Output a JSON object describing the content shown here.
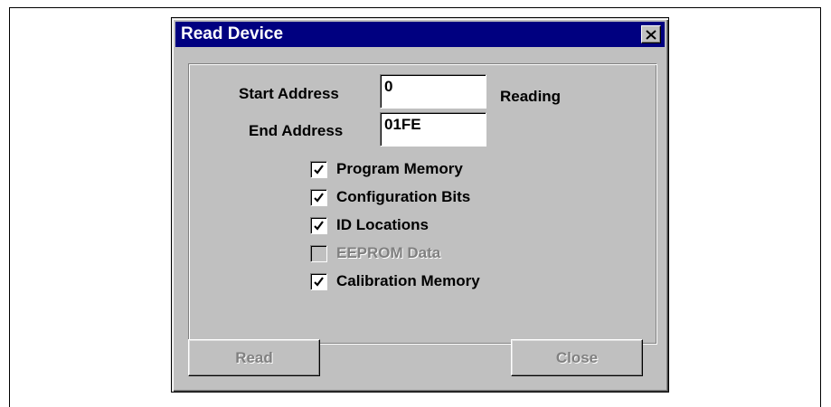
{
  "dialog": {
    "title": "Read Device",
    "close_icon": "close-x-icon"
  },
  "fields": {
    "start_address_label": "Start Address",
    "start_address_value": "0",
    "end_address_label": "End Address",
    "end_address_value": "01FE",
    "status_text": "Reading"
  },
  "checkboxes": [
    {
      "label": "Program Memory",
      "checked": true,
      "enabled": true
    },
    {
      "label": "Configuration Bits",
      "checked": true,
      "enabled": true
    },
    {
      "label": "ID Locations",
      "checked": true,
      "enabled": true
    },
    {
      "label": "EEPROM Data",
      "checked": false,
      "enabled": false
    },
    {
      "label": "Calibration Memory",
      "checked": true,
      "enabled": true
    }
  ],
  "buttons": {
    "read_label": "Read",
    "read_enabled": false,
    "close_label": "Close",
    "close_enabled": false
  },
  "colors": {
    "title_bar": "#000080",
    "dialog_face": "#c0c0c0",
    "disabled_text": "#808080"
  }
}
